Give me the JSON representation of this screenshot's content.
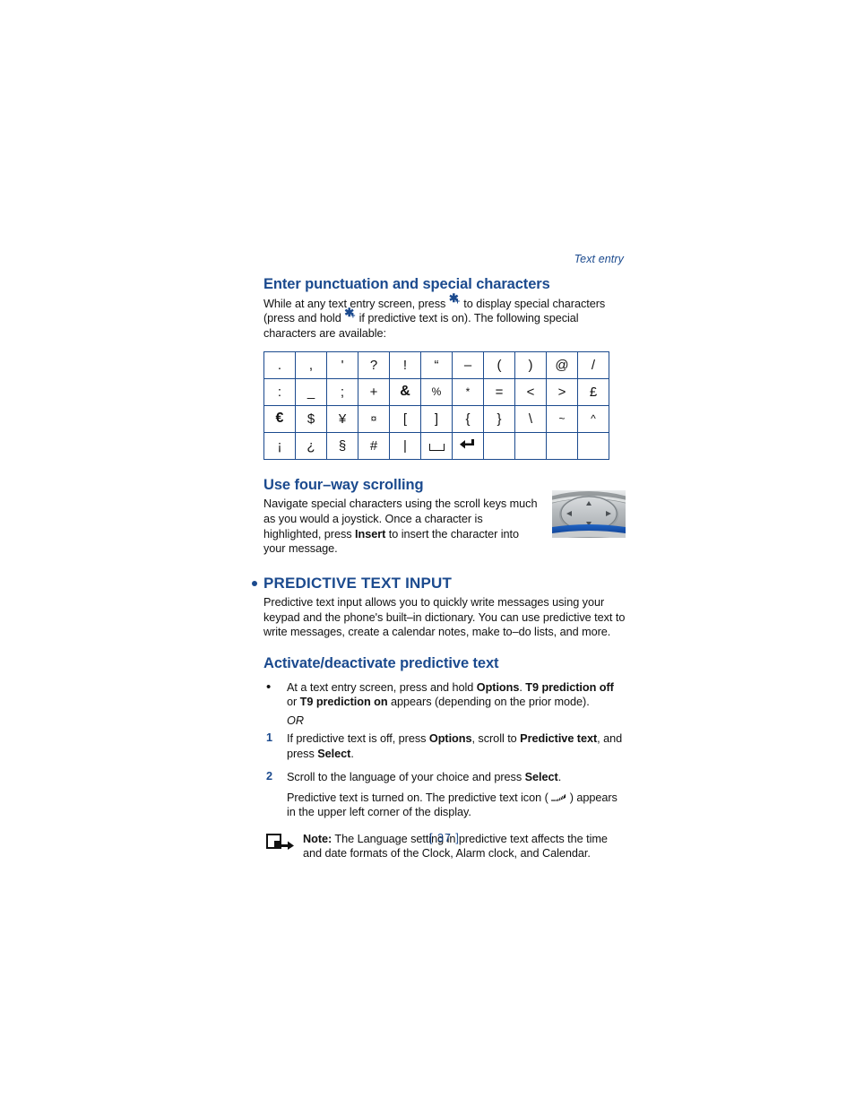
{
  "page": {
    "running_head": "Text entry",
    "page_number": "[ 37 ]"
  },
  "sections": {
    "punctuation": {
      "heading": "Enter punctuation and special characters",
      "intro_part1": "While at any text entry screen, press ",
      "intro_part2": " to display special characters (press and hold ",
      "intro_part3": " if predictive text is on). The following special characters are available:",
      "star_key_label": "*+"
    },
    "char_table": {
      "rows": [
        [
          ".",
          ",",
          "'",
          "?",
          "!",
          "“",
          "–",
          "(",
          ")",
          "@",
          "/"
        ],
        [
          ":",
          "_",
          ";",
          "+",
          "&",
          "%",
          "*",
          "=",
          "<",
          ">",
          "£"
        ],
        [
          "€",
          "$",
          "¥",
          "¤",
          "[",
          "]",
          "{",
          "}",
          "\\",
          "~",
          "^"
        ],
        [
          "¡",
          "¿",
          "§",
          "#",
          "|",
          "space",
          "return",
          "",
          "",
          "",
          ""
        ]
      ],
      "glyph_names": {
        "space": "space-bar-glyph",
        "return": "return-key-glyph"
      }
    },
    "scrolling": {
      "heading": "Use four–way scrolling",
      "body_part1": "Navigate special characters using the scroll keys much as you would a joystick. Once a character is highlighted, press ",
      "body_bold": "Insert",
      "body_part2": " to insert the character into your message.",
      "image_alt": "phone-scroll-key-photo"
    },
    "predictive": {
      "heading": "PREDICTIVE TEXT INPUT",
      "body": "Predictive text input allows you to quickly write messages using your keypad and the phone's built–in dictionary. You can use predictive text to write messages, create a calendar notes, make to–do lists, and more."
    },
    "activate": {
      "heading": "Activate/deactivate predictive text",
      "bullet": {
        "marker": "•",
        "part1": "At a text entry screen, press and hold ",
        "bold1": "Options",
        "part2": ". ",
        "bold2": "T9 prediction off",
        "part3": " or ",
        "bold3": "T9 prediction on",
        "part4": " appears (depending on the prior mode)."
      },
      "or_label": "OR",
      "step1": {
        "marker": "1",
        "part1": "If predictive text is off, press ",
        "bold1": "Options",
        "part2": ", scroll to ",
        "bold2": "Predictive text",
        "part3": ", and press ",
        "bold3": "Select",
        "part4": "."
      },
      "step2": {
        "marker": "2",
        "part1": "Scroll to the language of your choice and press ",
        "bold1": "Select",
        "part2": "."
      },
      "step2_note_part1": "Predictive text is turned on. The predictive text icon ( ",
      "step2_note_part2": " ) appears in the upper left corner of the display."
    },
    "note": {
      "label": "Note:",
      "text": " The Language setting in predictive text affects the time and date formats of the Clock, Alarm clock, and Calendar.",
      "icon_name": "note-arrow-icon"
    }
  },
  "colors": {
    "heading_blue": "#1b4a8e",
    "table_border": "#1b4a8e",
    "body_text": "#111111"
  }
}
